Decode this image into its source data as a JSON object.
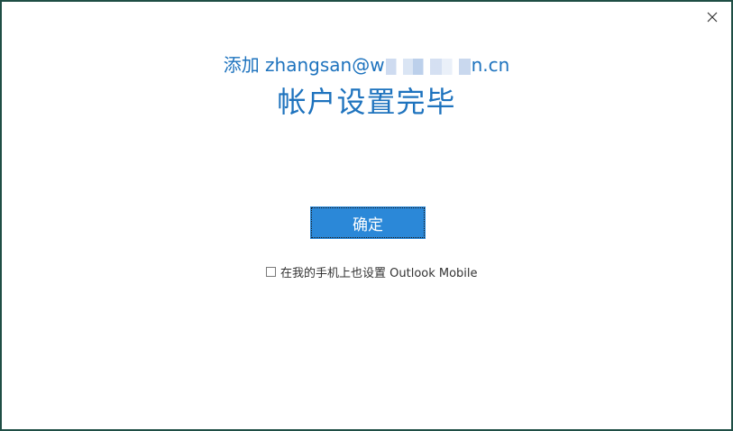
{
  "window": {
    "close_icon": "close-icon"
  },
  "heading": {
    "add_prefix": "添加 zhangsan@w",
    "add_suffix": "n.cn",
    "title": "帐户设置完毕"
  },
  "actions": {
    "ok_label": "确定",
    "mobile_checkbox_label": "在我的手机上也设置 Outlook Mobile",
    "mobile_checkbox_checked": false
  },
  "colors": {
    "accent": "#1e73be",
    "button": "#2b88d8",
    "border": "#1f4e45"
  }
}
